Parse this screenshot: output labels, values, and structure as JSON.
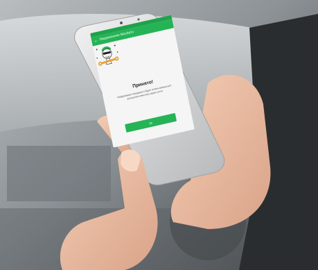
{
  "app": {
    "title": "Уведомление МосАвто",
    "back_icon": "arrow-back-icon"
  },
  "dialog": {
    "title": "Принято!",
    "message": "Информация передана и будет использована для улучшения качества наших услуг.",
    "ok_label": "Ok",
    "mascot_icon": "mechanic-mascot-with-wrench-icon"
  },
  "colors": {
    "primary": "#25b356",
    "status_bar": "#1ea34b",
    "wrench": "#e9a23b"
  }
}
